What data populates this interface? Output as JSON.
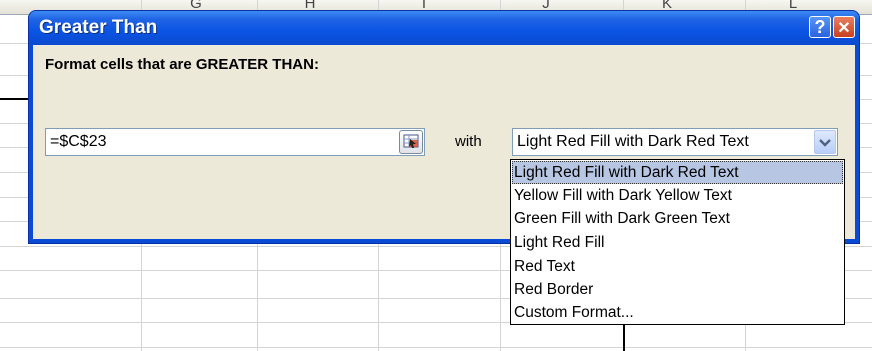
{
  "spreadsheet": {
    "column_letters": [
      "G",
      "H",
      "I",
      "J",
      "K",
      "L"
    ]
  },
  "dialog": {
    "title": "Greater Than",
    "help_glyph": "?",
    "close_glyph": "✕",
    "prompt": "Format cells that are GREATER THAN:",
    "value": "=$C$23",
    "with_label": "with",
    "format_selected": "Light Red Fill with Dark Red Text",
    "format_options": [
      "Light Red Fill with Dark Red Text",
      "Yellow Fill with Dark Yellow Text",
      "Green Fill with Dark Green Text",
      "Light Red Fill",
      "Red Text",
      "Red Border",
      "Custom Format..."
    ],
    "highlighted_option_index": 0,
    "icons": {
      "reference": "range-select-icon",
      "dropdown": "chevron-down-icon"
    },
    "colors": {
      "titlebar": "#0a54e3",
      "client": "#ece9d8",
      "highlight": "#b6c6e3"
    }
  }
}
